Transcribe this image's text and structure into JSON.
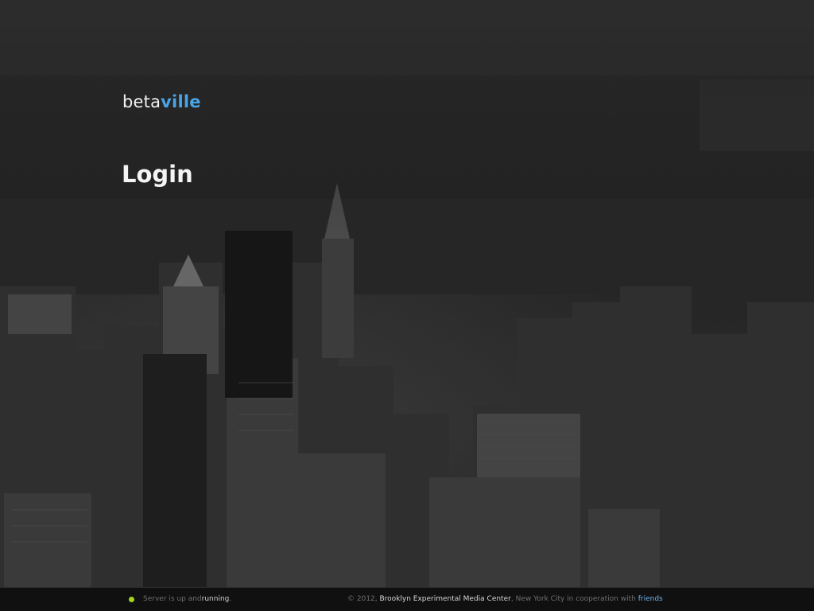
{
  "brand": {
    "name_plain": "beta",
    "name_accent": "ville",
    "accent_color": "#4aa3e6"
  },
  "page": {
    "heading": "Login"
  },
  "footer": {
    "status": {
      "indicator_color": "#a7d51c",
      "prefix": "Server is up and ",
      "state": "running",
      "suffix": "."
    },
    "credits": {
      "copyright": "© 2012, ",
      "organization": "Brooklyn Experimental Media Center",
      "location_text": ", New York City in cooperation with ",
      "link_text": "friends"
    }
  }
}
